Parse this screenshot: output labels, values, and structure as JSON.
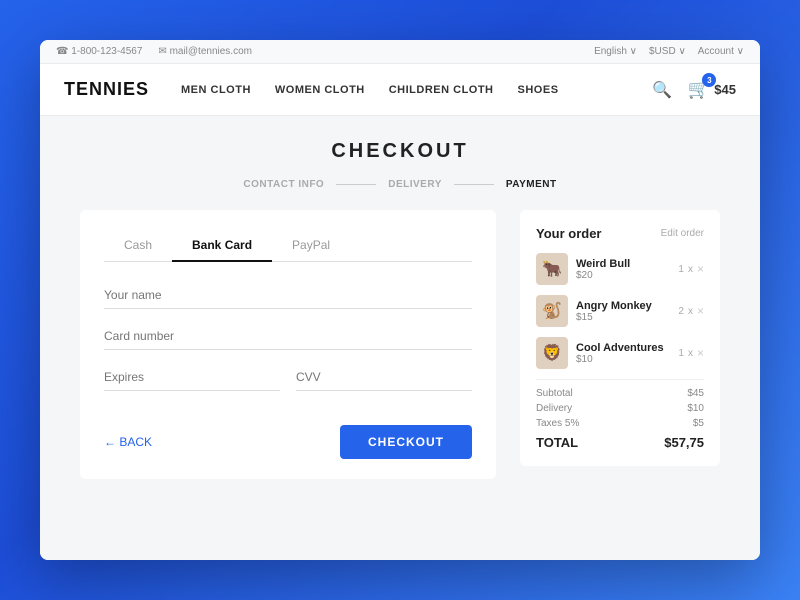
{
  "topbar": {
    "phone": "☎ 1-800-123-4567",
    "email": "✉ mail@tennies.com",
    "language": "English ∨",
    "currency": "$USD ∨",
    "account": "Account ∨"
  },
  "nav": {
    "brand": "TENNIES",
    "links": [
      {
        "label": "MEN CLOTH",
        "active": false
      },
      {
        "label": "WOMEN CLOTH",
        "active": false
      },
      {
        "label": "CHILDREN CLOTH",
        "active": false
      },
      {
        "label": "SHOES",
        "active": false
      }
    ],
    "cart_count": "3",
    "cart_amount": "45"
  },
  "page": {
    "title": "CHECKOUT"
  },
  "steps": [
    {
      "label": "CONTACT INFO",
      "active": false
    },
    {
      "label": "DELIVERY",
      "active": false
    },
    {
      "label": "PAYMENT",
      "active": true
    }
  ],
  "payment_tabs": [
    {
      "label": "Cash",
      "active": false
    },
    {
      "label": "Bank Card",
      "active": true
    },
    {
      "label": "PayPal",
      "active": false
    }
  ],
  "form": {
    "name_label": "Your name",
    "card_label": "Card number",
    "expires_label": "Expires",
    "cvv_label": "CVV",
    "back_label": "← BACK",
    "checkout_label": "CHECKOUT"
  },
  "order": {
    "title": "Your order",
    "edit_label": "Edit order",
    "items": [
      {
        "name": "Weird Bull",
        "price": "$20",
        "qty": "1",
        "emoji": "🐂"
      },
      {
        "name": "Angry Monkey",
        "price": "$15",
        "qty": "2",
        "emoji": "🐒"
      },
      {
        "name": "Cool Adventures",
        "price": "$10",
        "qty": "1",
        "emoji": "🦁"
      }
    ],
    "subtotal_label": "Subtotal",
    "subtotal_value": "$45",
    "delivery_label": "Delivery",
    "delivery_value": "$10",
    "taxes_label": "Taxes 5%",
    "taxes_value": "$5",
    "total_label": "TOTAL",
    "total_value": "$57,75"
  }
}
